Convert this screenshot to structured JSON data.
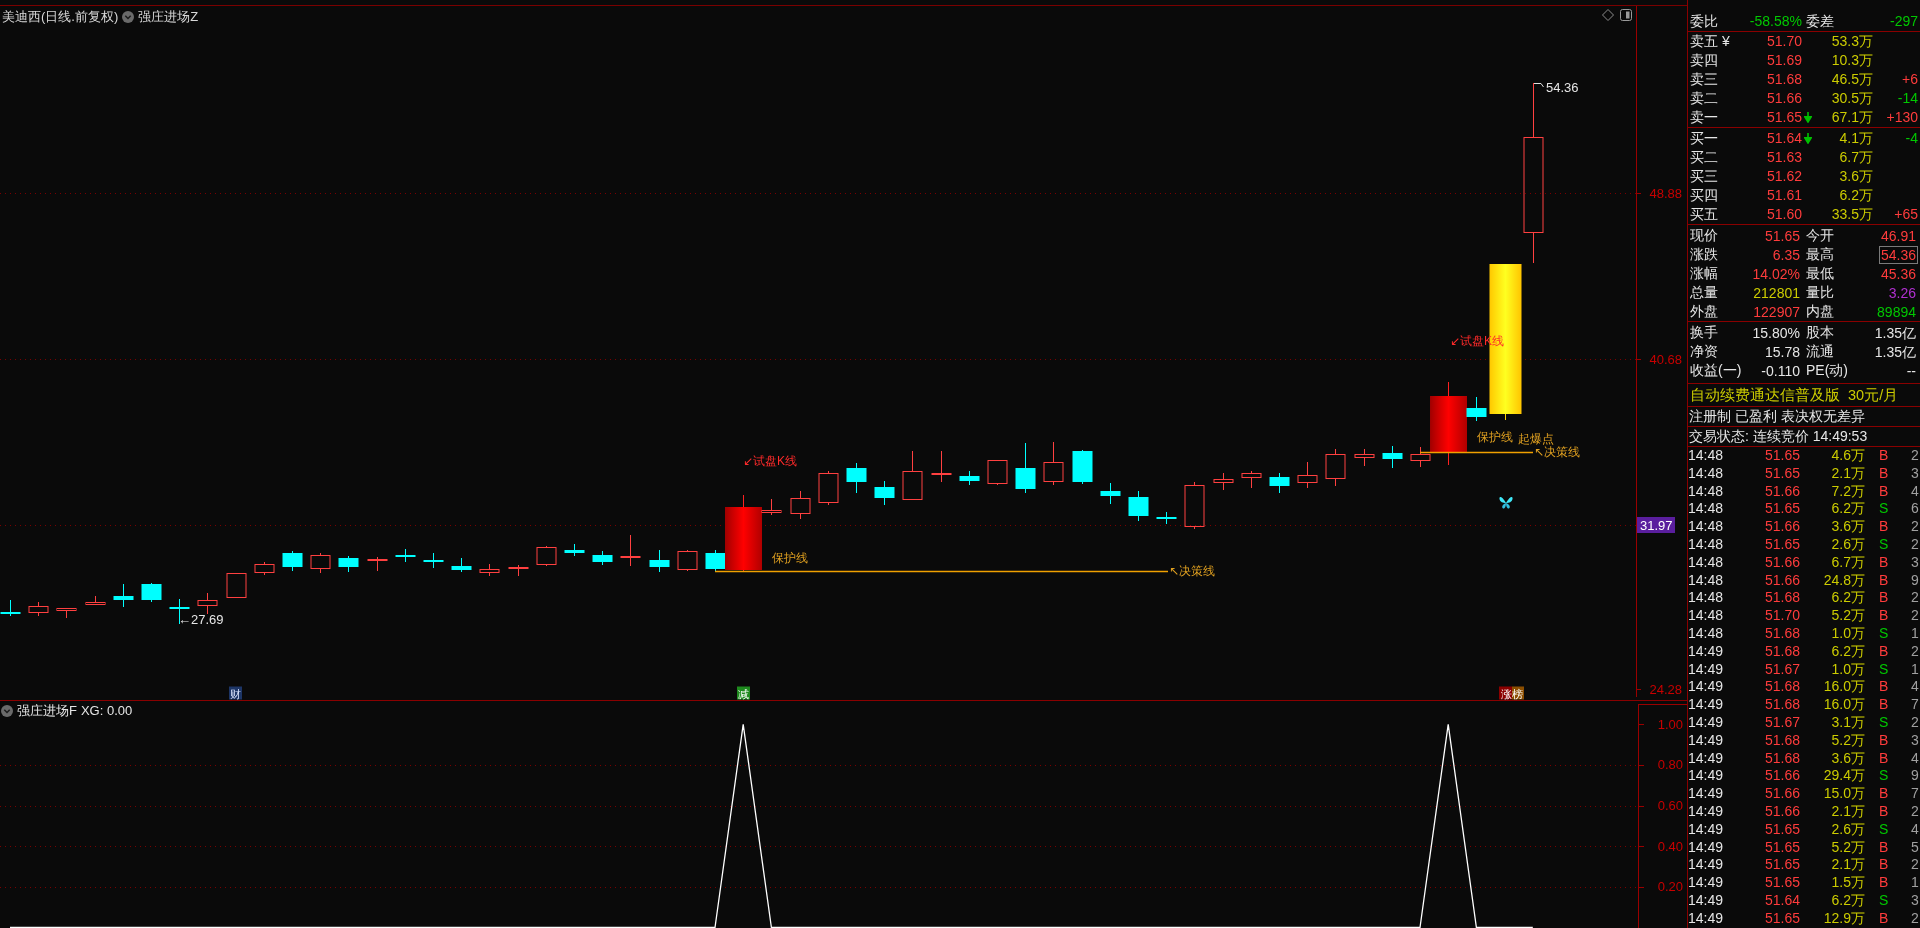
{
  "main_chart": {
    "title": "美迪西(日线.前复权)",
    "indicator": "强庄进场Z",
    "high_label": "54.36",
    "low_label": "←27.69",
    "setups": [
      {
        "trial_label": "↙试盘K线",
        "guard_label": "保护线",
        "decision_label": "↖决策线"
      },
      {
        "trial_label": "↙试盘K线",
        "guard_label": "保护线",
        "burst_label": "起爆点",
        "decision_label": "↖决策线"
      }
    ],
    "markers": [
      {
        "text": "财",
        "kind": "finance"
      },
      {
        "text": "减",
        "kind": "reduce"
      },
      {
        "text": "涨榜",
        "kind": "rank"
      }
    ],
    "price_axis": [
      {
        "label": "48.88",
        "highlighted": false
      },
      {
        "label": "40.68",
        "highlighted": false
      },
      {
        "label": "31.97",
        "highlighted": true
      },
      {
        "label": "24.28",
        "highlighted": false
      }
    ]
  },
  "sub_chart": {
    "indicator": "强庄进场F",
    "reading": "XG: 0.00",
    "chart_data": {
      "type": "line",
      "grid": true,
      "ylim": [
        0,
        1.1
      ],
      "yticks": [
        {
          "value": 0.2,
          "label": "0.20"
        },
        {
          "value": 0.4,
          "label": "0.40"
        },
        {
          "value": 0.6,
          "label": "0.60"
        },
        {
          "value": 0.8,
          "label": "0.80"
        },
        {
          "value": 1,
          "label": "1.00"
        }
      ],
      "values": [
        0,
        0,
        0,
        0,
        0,
        0,
        0,
        0,
        0,
        0,
        0,
        0,
        0,
        0,
        0,
        0,
        0,
        0,
        0,
        0,
        0,
        0,
        0,
        0,
        0,
        0,
        1,
        0,
        0,
        0,
        0,
        0,
        0,
        0,
        0,
        0,
        0,
        0,
        0,
        0,
        0,
        0,
        0,
        0,
        0,
        0,
        0,
        0,
        0,
        0,
        0,
        1,
        0,
        0,
        0
      ]
    }
  },
  "quote_panel": {
    "order_ratio": {
      "label": "委比",
      "value": "-58.58%"
    },
    "order_diff": {
      "label": "委差",
      "value": "-297"
    },
    "asks": [
      {
        "label": "卖五 ¥",
        "price": "51.70",
        "volume": "53.3万",
        "down_arrow": false
      },
      {
        "label": "卖四",
        "price": "51.69",
        "volume": "10.3万",
        "down_arrow": false
      },
      {
        "label": "卖三",
        "price": "51.68",
        "volume": "46.5万",
        "down_arrow": false,
        "change": "+6",
        "change_up": true
      },
      {
        "label": "卖二",
        "price": "51.66",
        "volume": "30.5万",
        "down_arrow": false,
        "change": "-14",
        "change_up": false
      },
      {
        "label": "卖一",
        "price": "51.65",
        "volume": "67.1万",
        "down_arrow": true,
        "change": "+130",
        "change_up": true
      }
    ],
    "bids": [
      {
        "label": "买一",
        "price": "51.64",
        "volume": "4.1万",
        "down_arrow": true,
        "change": "-4",
        "change_up": false
      },
      {
        "label": "买二",
        "price": "51.63",
        "volume": "6.7万",
        "down_arrow": false
      },
      {
        "label": "买三",
        "price": "51.62",
        "volume": "3.6万",
        "down_arrow": false
      },
      {
        "label": "买四",
        "price": "51.61",
        "volume": "6.2万",
        "down_arrow": false
      },
      {
        "label": "买五",
        "price": "51.60",
        "volume": "33.5万",
        "down_arrow": false,
        "change": "+65",
        "change_up": true
      }
    ],
    "stats": [
      {
        "label": "现价",
        "value": "51.65",
        "kind": "rise",
        "boxed": false
      },
      {
        "label": "今开",
        "value": "46.91",
        "kind": "rise",
        "boxed": false
      },
      {
        "label": "涨跌",
        "value": "6.35",
        "kind": "rise",
        "boxed": false
      },
      {
        "label": "最高",
        "value": "54.36",
        "kind": "rise",
        "boxed": true
      },
      {
        "label": "涨幅",
        "value": "14.02%",
        "kind": "rise",
        "boxed": false
      },
      {
        "label": "最低",
        "value": "45.36",
        "kind": "rise",
        "boxed": false
      },
      {
        "label": "总量",
        "value": "212801",
        "kind": "volume",
        "boxed": false
      },
      {
        "label": "量比",
        "value": "3.26",
        "kind": "ratio",
        "boxed": false
      },
      {
        "label": "外盘",
        "value": "122907",
        "kind": "rise",
        "boxed": false
      },
      {
        "label": "内盘",
        "value": "89894",
        "kind": "fall",
        "boxed": false
      }
    ],
    "fundamentals": [
      {
        "label": "换手",
        "value": "15.80%"
      },
      {
        "label": "股本",
        "value": "1.35亿"
      },
      {
        "label": "净资",
        "value": "15.78"
      },
      {
        "label": "流通",
        "value": "1.35亿"
      },
      {
        "label": "收益(一)",
        "value": "-0.110"
      },
      {
        "label": "PE(动)",
        "value": "--"
      }
    ],
    "promo": [
      "自动续费通达信普及版",
      "30元/月"
    ],
    "tags": "注册制 已盈利 表决权无差异",
    "trade_status": "交易状态: 连续竞价 14:49:53",
    "trades": [
      {
        "time": "14:48",
        "price": "51.65",
        "volume": "4.6万",
        "side": "B",
        "count": "2",
        "kind": "buy"
      },
      {
        "time": "14:48",
        "price": "51.65",
        "volume": "2.1万",
        "side": "B",
        "count": "3",
        "kind": "buy"
      },
      {
        "time": "14:48",
        "price": "51.66",
        "volume": "7.2万",
        "side": "B",
        "count": "4",
        "kind": "buy"
      },
      {
        "time": "14:48",
        "price": "51.65",
        "volume": "6.2万",
        "side": "S",
        "count": "6",
        "kind": "sell"
      },
      {
        "time": "14:48",
        "price": "51.66",
        "volume": "3.6万",
        "side": "B",
        "count": "2",
        "kind": "buy"
      },
      {
        "time": "14:48",
        "price": "51.65",
        "volume": "2.6万",
        "side": "S",
        "count": "2",
        "kind": "sell"
      },
      {
        "time": "14:48",
        "price": "51.66",
        "volume": "6.7万",
        "side": "B",
        "count": "3",
        "kind": "buy"
      },
      {
        "time": "14:48",
        "price": "51.66",
        "volume": "24.8万",
        "side": "B",
        "count": "9",
        "kind": "buy"
      },
      {
        "time": "14:48",
        "price": "51.68",
        "volume": "6.2万",
        "side": "B",
        "count": "2",
        "kind": "buy"
      },
      {
        "time": "14:48",
        "price": "51.70",
        "volume": "5.2万",
        "side": "B",
        "count": "2",
        "kind": "buy"
      },
      {
        "time": "14:48",
        "price": "51.68",
        "volume": "1.0万",
        "side": "S",
        "count": "1",
        "kind": "sell"
      },
      {
        "time": "14:49",
        "price": "51.68",
        "volume": "6.2万",
        "side": "B",
        "count": "2",
        "kind": "buy"
      },
      {
        "time": "14:49",
        "price": "51.67",
        "volume": "1.0万",
        "side": "S",
        "count": "1",
        "kind": "sell"
      },
      {
        "time": "14:49",
        "price": "51.68",
        "volume": "16.0万",
        "side": "B",
        "count": "4",
        "kind": "buy"
      },
      {
        "time": "14:49",
        "price": "51.68",
        "volume": "16.0万",
        "side": "B",
        "count": "7",
        "kind": "buy"
      },
      {
        "time": "14:49",
        "price": "51.67",
        "volume": "3.1万",
        "side": "S",
        "count": "2",
        "kind": "sell"
      },
      {
        "time": "14:49",
        "price": "51.68",
        "volume": "5.2万",
        "side": "B",
        "count": "3",
        "kind": "buy"
      },
      {
        "time": "14:49",
        "price": "51.68",
        "volume": "3.6万",
        "side": "B",
        "count": "4",
        "kind": "buy"
      },
      {
        "time": "14:49",
        "price": "51.66",
        "volume": "29.4万",
        "side": "S",
        "count": "9",
        "kind": "sell"
      },
      {
        "time": "14:49",
        "price": "51.66",
        "volume": "15.0万",
        "side": "B",
        "count": "7",
        "kind": "buy"
      },
      {
        "time": "14:49",
        "price": "51.66",
        "volume": "2.1万",
        "side": "B",
        "count": "2",
        "kind": "buy"
      },
      {
        "time": "14:49",
        "price": "51.65",
        "volume": "2.6万",
        "side": "S",
        "count": "4",
        "kind": "sell"
      },
      {
        "time": "14:49",
        "price": "51.65",
        "volume": "5.2万",
        "side": "B",
        "count": "5",
        "kind": "buy"
      },
      {
        "time": "14:49",
        "price": "51.65",
        "volume": "2.1万",
        "side": "B",
        "count": "2",
        "kind": "buy"
      },
      {
        "time": "14:49",
        "price": "51.65",
        "volume": "1.5万",
        "side": "B",
        "count": "1",
        "kind": "buy"
      },
      {
        "time": "14:49",
        "price": "51.64",
        "volume": "6.2万",
        "side": "S",
        "count": "3",
        "kind": "sell"
      },
      {
        "time": "14:49",
        "price": "51.65",
        "volume": "12.9万",
        "side": "B",
        "count": "2",
        "kind": "buy"
      }
    ]
  }
}
